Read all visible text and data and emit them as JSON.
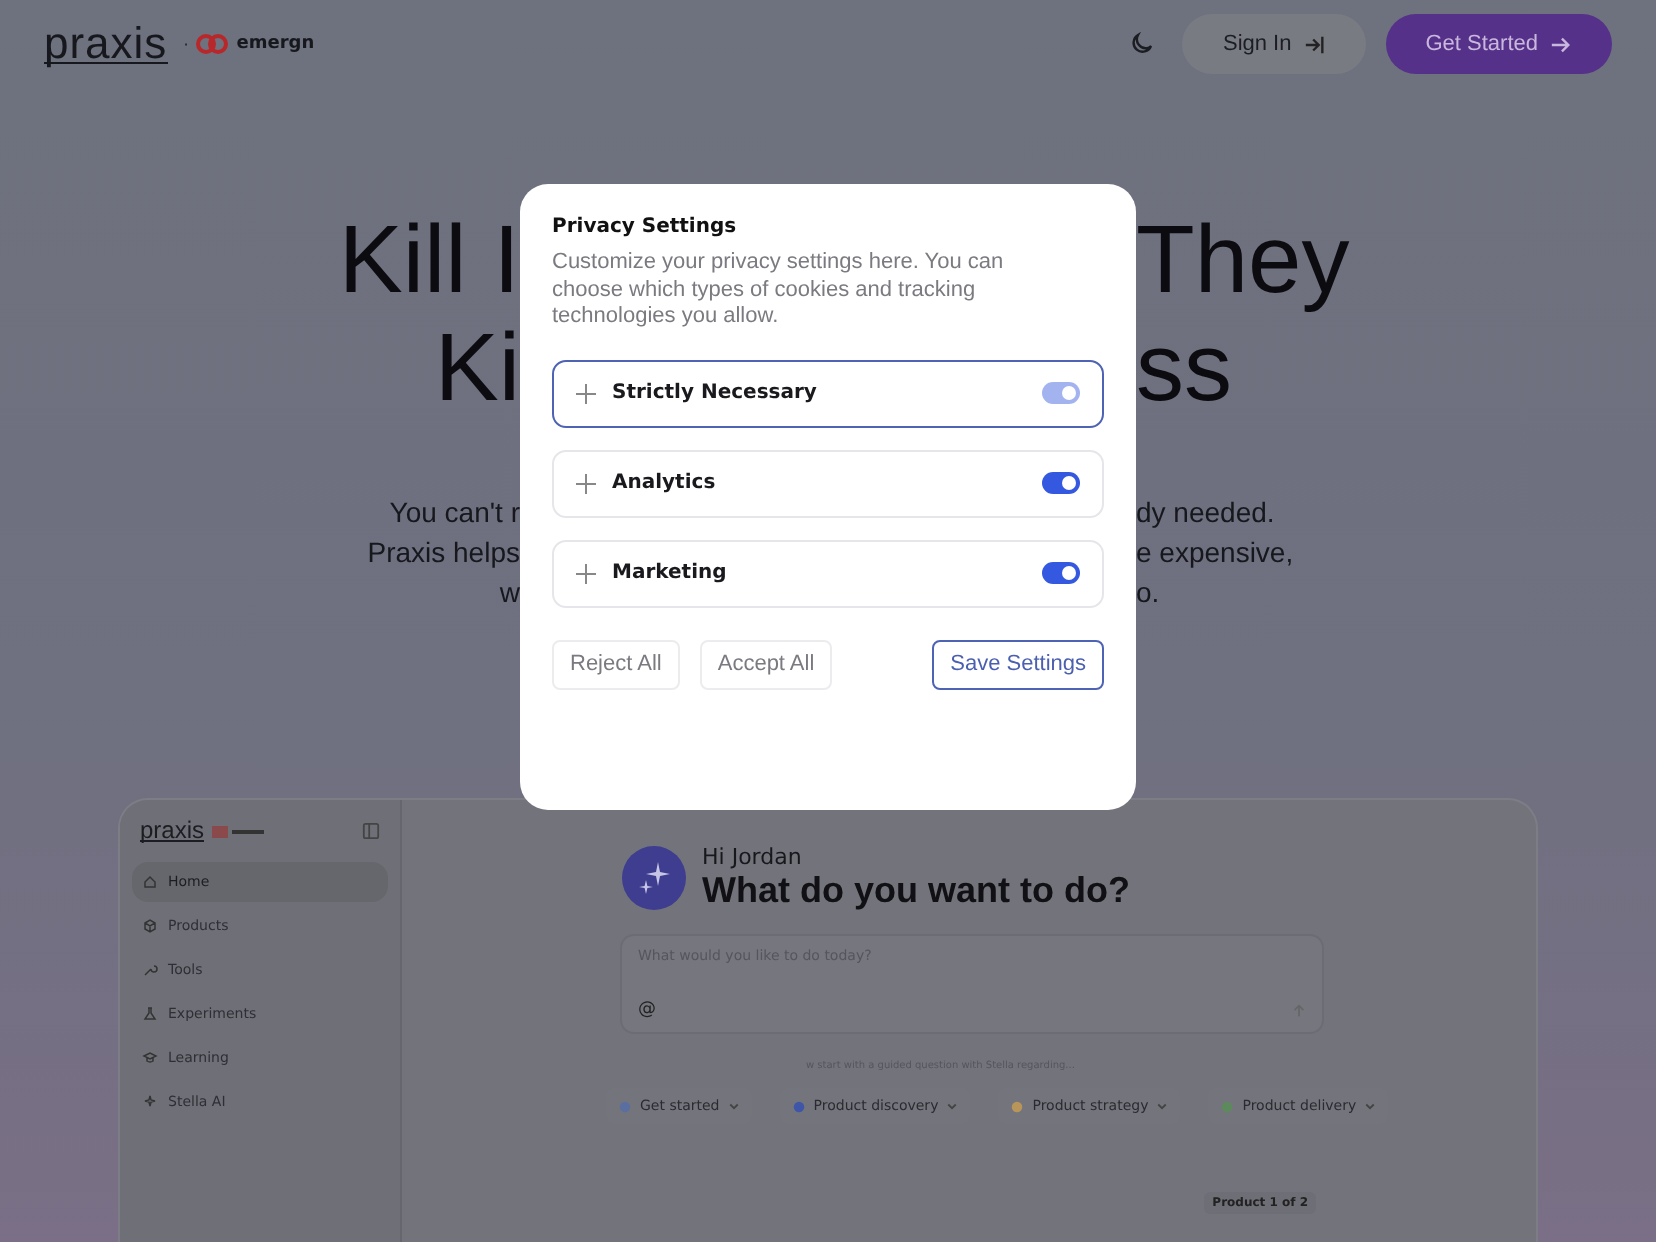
{
  "header": {
    "logo": "praxis",
    "separator": "·",
    "partner": "emergn",
    "sign_in": "Sign In",
    "get_started": "Get Started"
  },
  "hero": {
    "headline": [
      {
        "left": "Kill I",
        "right": "They"
      },
      {
        "left": "Ki",
        "right": "ss"
      }
    ],
    "subtitle": [
      {
        "left": "You can't r",
        "right": "dy needed."
      },
      {
        "left": "Praxis helps",
        "right": "e expensive,"
      },
      {
        "left": "w",
        "right": "o."
      }
    ]
  },
  "privacy_modal": {
    "title": "Privacy Settings",
    "description": "Customize your privacy settings here. You can choose which types of cookies and tracking technologies you allow.",
    "categories": [
      {
        "label": "Strictly Necessary",
        "focused": true,
        "on": true,
        "disabled": true
      },
      {
        "label": "Analytics",
        "focused": false,
        "on": true,
        "disabled": false
      },
      {
        "label": "Marketing",
        "focused": false,
        "on": true,
        "disabled": false
      }
    ],
    "buttons": [
      {
        "label": "Reject All",
        "kind": "secondary"
      },
      {
        "label": "Accept All",
        "kind": "secondary"
      },
      {
        "label": "Save Settings",
        "kind": "primary"
      }
    ]
  },
  "app_preview": {
    "logo": "praxis",
    "nav": [
      {
        "label": "Home",
        "selected": true
      },
      {
        "label": "Products",
        "selected": false
      },
      {
        "label": "Tools",
        "selected": false
      },
      {
        "label": "Experiments",
        "selected": false
      },
      {
        "label": "Learning",
        "selected": false
      },
      {
        "label": "Stella AI",
        "selected": false
      }
    ],
    "greeting": "Hi Jordan",
    "heading": "What do you want to do?",
    "prompt": {
      "placeholder": "What would you like to do today?",
      "mention": "@"
    },
    "hint": "w start with a guided question with Stella regarding...",
    "chips": [
      "Get started",
      "Product discovery",
      "Product strategy",
      "Product delivery"
    ],
    "pager": "Product 1 of 2"
  }
}
